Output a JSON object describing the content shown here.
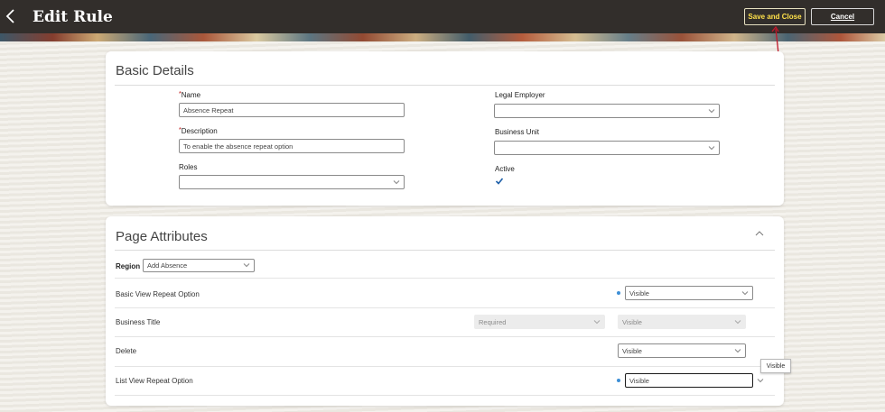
{
  "header": {
    "title": "Edit Rule",
    "save_label": "Save and Close",
    "cancel_label": "Cancel",
    "save_text_color": "#ffe14a"
  },
  "basic_details": {
    "title": "Basic Details",
    "name_label": "Name",
    "name_value": "Absence Repeat",
    "description_label": "Description",
    "description_value": "To enable the absence repeat option",
    "roles_label": "Roles",
    "roles_value": "",
    "legal_employer_label": "Legal Employer",
    "legal_employer_value": "",
    "business_unit_label": "Business Unit",
    "business_unit_value": "",
    "active_label": "Active",
    "active_checked": true,
    "required_marker": "*"
  },
  "page_attributes": {
    "title": "Page Attributes",
    "region_label": "Region",
    "region_value": "Add Absence",
    "rows": [
      {
        "label": "Basic View Repeat Option",
        "visibility": "Visible",
        "changed": true
      },
      {
        "label": "Business Title",
        "requirement": "Required",
        "visibility": "Visible",
        "disabled": true
      },
      {
        "label": "Delete",
        "visibility": "Visible"
      },
      {
        "label": "List View Repeat Option",
        "visibility": "Visible",
        "changed": true,
        "focused": true
      }
    ],
    "tooltip": "Visible"
  },
  "colors": {
    "header_bg": "#322e2b",
    "accent_blue": "#3d8fd6",
    "page_bg": "#eeebe4"
  }
}
